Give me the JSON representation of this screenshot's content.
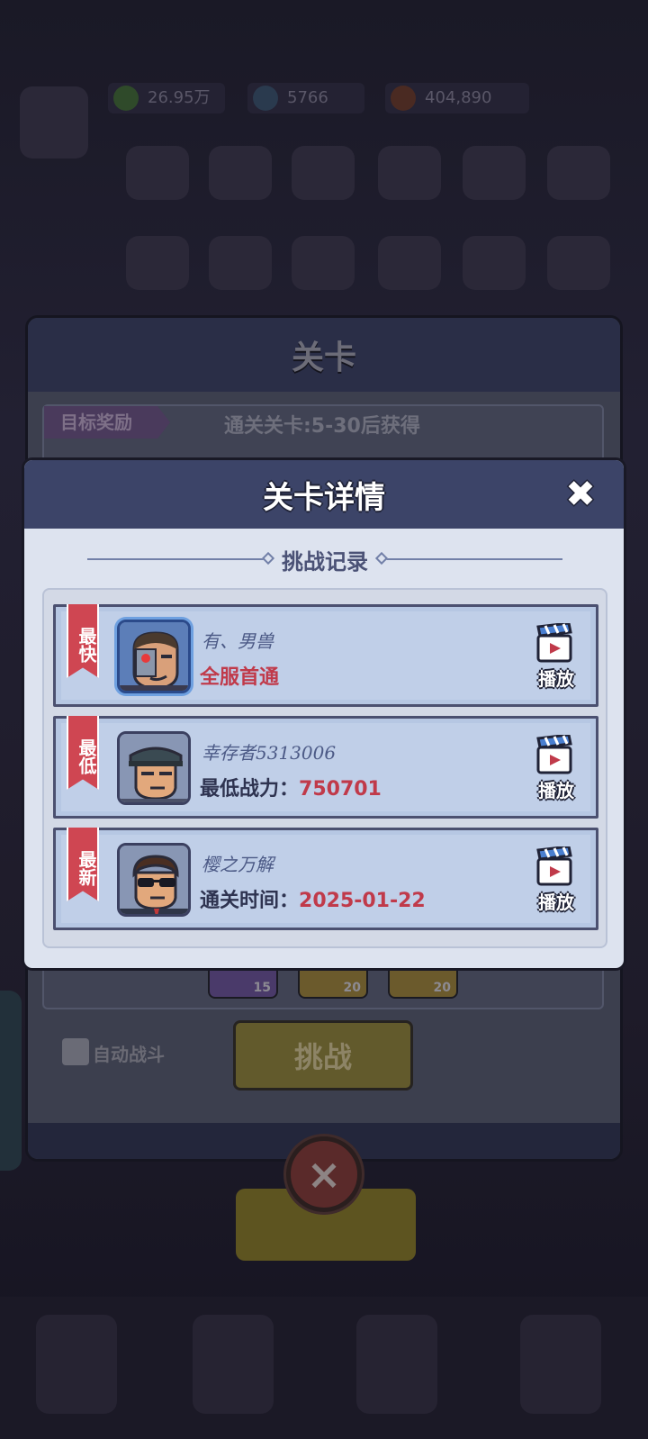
{
  "background": {
    "resources": [
      "26.95万",
      "5766",
      "404,890"
    ]
  },
  "stage_panel": {
    "title": "关卡",
    "target_tag": "目标奖励",
    "target_text": "通关关卡:5-30后获得",
    "rewards": [
      {
        "count": "15",
        "color": "#4a3a6a"
      },
      {
        "count": "20",
        "color": "#6b5a2c"
      },
      {
        "count": "20",
        "color": "#6b5a2c"
      }
    ],
    "auto_battle_label": "自动战斗",
    "challenge_label": "挑战",
    "close_icon": "×"
  },
  "detail": {
    "title": "关卡详情",
    "close_icon": "✖",
    "section_title": "挑战记录",
    "records": [
      {
        "ribbon": "最快",
        "avatar": "cyborg-avatar",
        "name": "有、男兽",
        "stat_label": "",
        "stat_value": "全服首通",
        "play_label": "播放"
      },
      {
        "ribbon": "最低",
        "avatar": "agent-avatar",
        "name": "幸存者5313006",
        "stat_label": "最低战力：",
        "stat_value": "750701",
        "play_label": "播放"
      },
      {
        "ribbon": "最新",
        "avatar": "sunglasses-avatar",
        "name": "樱之万解",
        "stat_label": "通关时间：",
        "stat_value": "2025-01-22",
        "play_label": "播放"
      }
    ]
  }
}
